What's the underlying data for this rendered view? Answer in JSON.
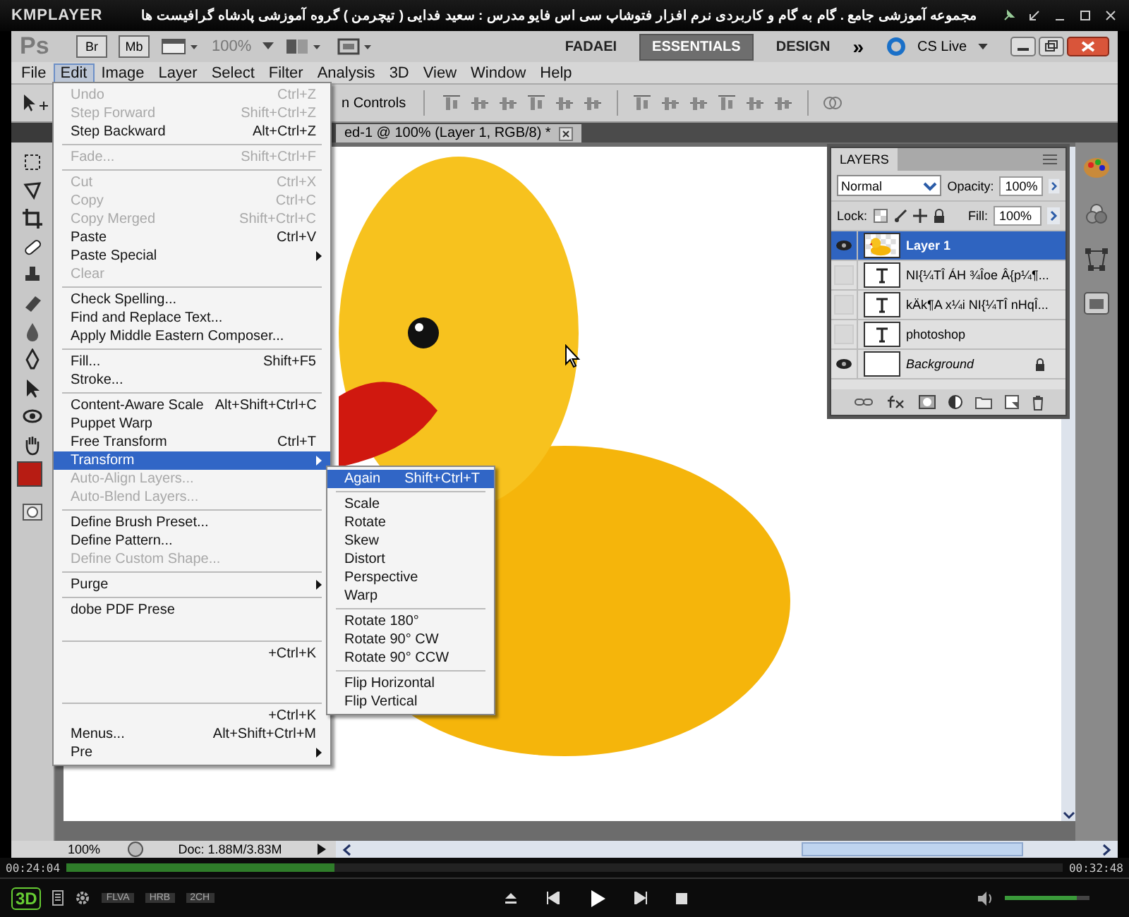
{
  "player": {
    "logo": "KMPLAYER",
    "title": "مجموعه آموزشی جامع . گام به گام و کاربردی نرم افزار فتوشاپ سی اس فایو  مدرس : سعید فدایی ( تیچرمن ) گروه آموزشی پادشاه گرافیست ها"
  },
  "app_bar": {
    "logo": "Ps",
    "buttons": [
      "Br",
      "Mb"
    ],
    "zoom": "100%",
    "workspaces": [
      {
        "label": "FADAEI",
        "selected": false
      },
      {
        "label": "ESSENTIALS",
        "selected": true
      },
      {
        "label": "DESIGN",
        "selected": false
      }
    ],
    "more": "»",
    "cs_live": "CS Live"
  },
  "menu_bar": [
    {
      "label": "File",
      "selected": false
    },
    {
      "label": "Edit",
      "selected": true
    },
    {
      "label": "Image",
      "selected": false
    },
    {
      "label": "Layer",
      "selected": false
    },
    {
      "label": "Select",
      "selected": false
    },
    {
      "label": "Filter",
      "selected": false
    },
    {
      "label": "Analysis",
      "selected": false
    },
    {
      "label": "3D",
      "selected": false
    },
    {
      "label": "View",
      "selected": false
    },
    {
      "label": "Window",
      "selected": false
    },
    {
      "label": "Help",
      "selected": false
    }
  ],
  "options_bar": {
    "label": "n Controls"
  },
  "document_tab": {
    "title": "ed-1 @ 100% (Layer 1, RGB/8) *"
  },
  "edit_menu": [
    {
      "kind": "item",
      "label": "Undo",
      "shortcut": "Ctrl+Z",
      "disabled": true,
      "submenu": false,
      "selected": false
    },
    {
      "kind": "item",
      "label": "Step Forward",
      "shortcut": "Shift+Ctrl+Z",
      "disabled": true,
      "submenu": false,
      "selected": false
    },
    {
      "kind": "item",
      "label": "Step Backward",
      "shortcut": "Alt+Ctrl+Z",
      "disabled": false,
      "submenu": false,
      "selected": false
    },
    {
      "kind": "separator"
    },
    {
      "kind": "item",
      "label": "Fade...",
      "shortcut": "Shift+Ctrl+F",
      "disabled": true,
      "submenu": false,
      "selected": false
    },
    {
      "kind": "separator"
    },
    {
      "kind": "item",
      "label": "Cut",
      "shortcut": "Ctrl+X",
      "disabled": true,
      "submenu": false,
      "selected": false
    },
    {
      "kind": "item",
      "label": "Copy",
      "shortcut": "Ctrl+C",
      "disabled": true,
      "submenu": false,
      "selected": false
    },
    {
      "kind": "item",
      "label": "Copy Merged",
      "shortcut": "Shift+Ctrl+C",
      "disabled": true,
      "submenu": false,
      "selected": false
    },
    {
      "kind": "item",
      "label": "Paste",
      "shortcut": "Ctrl+V",
      "disabled": false,
      "submenu": false,
      "selected": false
    },
    {
      "kind": "item",
      "label": "Paste Special",
      "disabled": false,
      "submenu": true,
      "selected": false
    },
    {
      "kind": "item",
      "label": "Clear",
      "disabled": true,
      "submenu": false,
      "selected": false
    },
    {
      "kind": "separator"
    },
    {
      "kind": "item",
      "label": "Check Spelling...",
      "disabled": false,
      "submenu": false,
      "selected": false
    },
    {
      "kind": "item",
      "label": "Find and Replace Text...",
      "disabled": false,
      "submenu": false,
      "selected": false
    },
    {
      "kind": "item",
      "label": "Apply Middle Eastern Composer...",
      "disabled": false,
      "submenu": false,
      "selected": false
    },
    {
      "kind": "separator"
    },
    {
      "kind": "item",
      "label": "Fill...",
      "shortcut": "Shift+F5",
      "disabled": false,
      "submenu": false,
      "selected": false
    },
    {
      "kind": "item",
      "label": "Stroke...",
      "disabled": false,
      "submenu": false,
      "selected": false
    },
    {
      "kind": "separator"
    },
    {
      "kind": "item",
      "label": "Content-Aware Scale",
      "shortcut": "Alt+Shift+Ctrl+C",
      "disabled": false,
      "submenu": false,
      "selected": false
    },
    {
      "kind": "item",
      "label": "Puppet Warp",
      "disabled": false,
      "submenu": false,
      "selected": false
    },
    {
      "kind": "item",
      "label": "Free Transform",
      "shortcut": "Ctrl+T",
      "disabled": false,
      "submenu": false,
      "selected": false
    },
    {
      "kind": "item",
      "label": "Transform",
      "disabled": false,
      "submenu": true,
      "selected": true
    },
    {
      "kind": "item",
      "label": "Auto-Align Layers...",
      "disabled": true,
      "submenu": false,
      "selected": false
    },
    {
      "kind": "item",
      "label": "Auto-Blend Layers...",
      "disabled": true,
      "submenu": false,
      "selected": false
    },
    {
      "kind": "separator"
    },
    {
      "kind": "item",
      "label": "Define Brush Preset...",
      "disabled": false,
      "submenu": false,
      "selected": false
    },
    {
      "kind": "item",
      "label": "Define Pattern...",
      "disabled": false,
      "submenu": false,
      "selected": false
    },
    {
      "kind": "item",
      "label": "Define Custom Shape...",
      "disabled": true,
      "submenu": false,
      "selected": false
    },
    {
      "kind": "separator"
    },
    {
      "kind": "item",
      "label": "Purge",
      "disabled": false,
      "submenu": true,
      "selected": false
    },
    {
      "kind": "separator"
    },
    {
      "kind": "item",
      "label": "dobe PDF Prese",
      "disabled": false,
      "submenu": false,
      "selected": false
    },
    {
      "kind": "hidden"
    },
    {
      "kind": "separator"
    },
    {
      "kind": "item",
      "shortcut": "+Ctrl+K",
      "disabled": false,
      "submenu": false,
      "selected": false
    },
    {
      "kind": "hidden"
    },
    {
      "kind": "hidden"
    },
    {
      "kind": "separator"
    },
    {
      "kind": "item",
      "shortcut": "+Ctrl+K",
      "disabled": false,
      "submenu": false,
      "selected": false
    },
    {
      "kind": "item",
      "label": "Menus...",
      "shortcut": "Alt+Shift+Ctrl+M",
      "disabled": false,
      "submenu": false,
      "selected": false
    },
    {
      "kind": "item",
      "label": "Pre",
      "disabled": false,
      "submenu": true,
      "selected": false
    }
  ],
  "transform_submenu": [
    {
      "kind": "item",
      "label": "Again",
      "shortcut": "Shift+Ctrl+T",
      "selected": true
    },
    {
      "kind": "separator"
    },
    {
      "kind": "item",
      "label": "Scale",
      "selected": false
    },
    {
      "kind": "item",
      "label": "Rotate",
      "selected": false
    },
    {
      "kind": "item",
      "label": "Skew",
      "selected": false
    },
    {
      "kind": "item",
      "label": "Distort",
      "selected": false
    },
    {
      "kind": "item",
      "label": "Perspective",
      "selected": false
    },
    {
      "kind": "item",
      "label": "Warp",
      "selected": false
    },
    {
      "kind": "separator"
    },
    {
      "kind": "item",
      "label": "Rotate 180°",
      "selected": false
    },
    {
      "kind": "item",
      "label": "Rotate 90° CW",
      "selected": false
    },
    {
      "kind": "item",
      "label": "Rotate 90° CCW",
      "selected": false
    },
    {
      "kind": "separator"
    },
    {
      "kind": "item",
      "label": "Flip Horizontal",
      "selected": false
    },
    {
      "kind": "item",
      "label": "Flip Vertical",
      "selected": false
    }
  ],
  "layers_panel": {
    "title": "LAYERS",
    "blend_mode": "Normal",
    "opacity_label": "Opacity:",
    "opacity": "100%",
    "lock_label": "Lock:",
    "fill_label": "Fill:",
    "fill": "100%",
    "layers": [
      {
        "name": "Layer 1",
        "kind": "image",
        "visible": true,
        "selected": true,
        "locked": false
      },
      {
        "name": "NI{¼TÎ ÁH ¾Îoe Â{p¼¶...",
        "kind": "text",
        "visible": false,
        "selected": false,
        "locked": false
      },
      {
        "name": "kÄk¶A x¼i NI{¼TÎ nHqÎ...",
        "kind": "text",
        "visible": false,
        "selected": false,
        "locked": false
      },
      {
        "name": "photoshop",
        "kind": "text",
        "visible": false,
        "selected": false,
        "locked": false
      },
      {
        "name": "Background",
        "kind": "background",
        "visible": true,
        "selected": false,
        "locked": true
      }
    ]
  },
  "status_bar": {
    "zoom": "100%",
    "doc": "Doc: 1.88M/3.83M"
  },
  "playback": {
    "elapsed": "00:24:04",
    "total": "00:32:48",
    "level": 0.27,
    "logo": "3D",
    "badges": [
      "FLVA",
      "HRB",
      "2CH"
    ],
    "volume": {
      "level": 0.85
    }
  }
}
